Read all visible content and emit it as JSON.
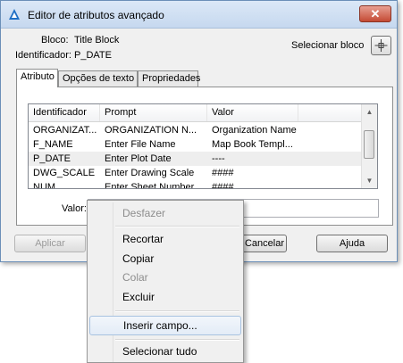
{
  "window": {
    "title": "Editor de atributos avançado",
    "close_glyph": "✕"
  },
  "header": {
    "block_label": "Bloco:",
    "block_value": "Title Block",
    "id_label": "Identificador:",
    "id_value": "P_DATE",
    "select_block_label": "Selecionar bloco"
  },
  "tabs": [
    {
      "label": "Atributo",
      "active": true
    },
    {
      "label": "Opções de texto",
      "active": false
    },
    {
      "label": "Propriedades",
      "active": false
    }
  ],
  "list": {
    "columns": [
      "Identificador",
      "Prompt",
      "Valor"
    ],
    "rows": [
      [
        "ORGANIZAT...",
        "ORGANIZATION N...",
        "Organization Name"
      ],
      [
        "F_NAME",
        "Enter File Name",
        "Map Book Templ..."
      ],
      [
        "P_DATE",
        "Enter Plot Date",
        "----"
      ],
      [
        "DWG_SCALE",
        "Enter Drawing Scale",
        "####"
      ],
      [
        "NUM",
        "Enter Sheet Number",
        "####"
      ]
    ],
    "selected_row": 2
  },
  "value_field": {
    "label": "Valor:",
    "value": ""
  },
  "buttons": {
    "apply": "Aplicar",
    "cancel": "Cancelar",
    "help": "Ajuda"
  },
  "context_menu": {
    "items": [
      {
        "label": "Desfazer",
        "enabled": false
      },
      {
        "label": "Recortar",
        "enabled": true
      },
      {
        "label": "Copiar",
        "enabled": true
      },
      {
        "label": "Colar",
        "enabled": false
      },
      {
        "label": "Excluir",
        "enabled": true
      },
      {
        "label": "Inserir campo...",
        "enabled": true,
        "highlighted": true
      },
      {
        "label": "Selecionar tudo",
        "enabled": true
      }
    ]
  },
  "icons": {
    "app": "autocad-a-icon",
    "select_block": "crosshair-pick-icon"
  },
  "colors": {
    "titlebar": "#c6d8ef",
    "close": "#c44a34",
    "selection": "#eeeeee",
    "app_icon": "#1f6fc5"
  }
}
